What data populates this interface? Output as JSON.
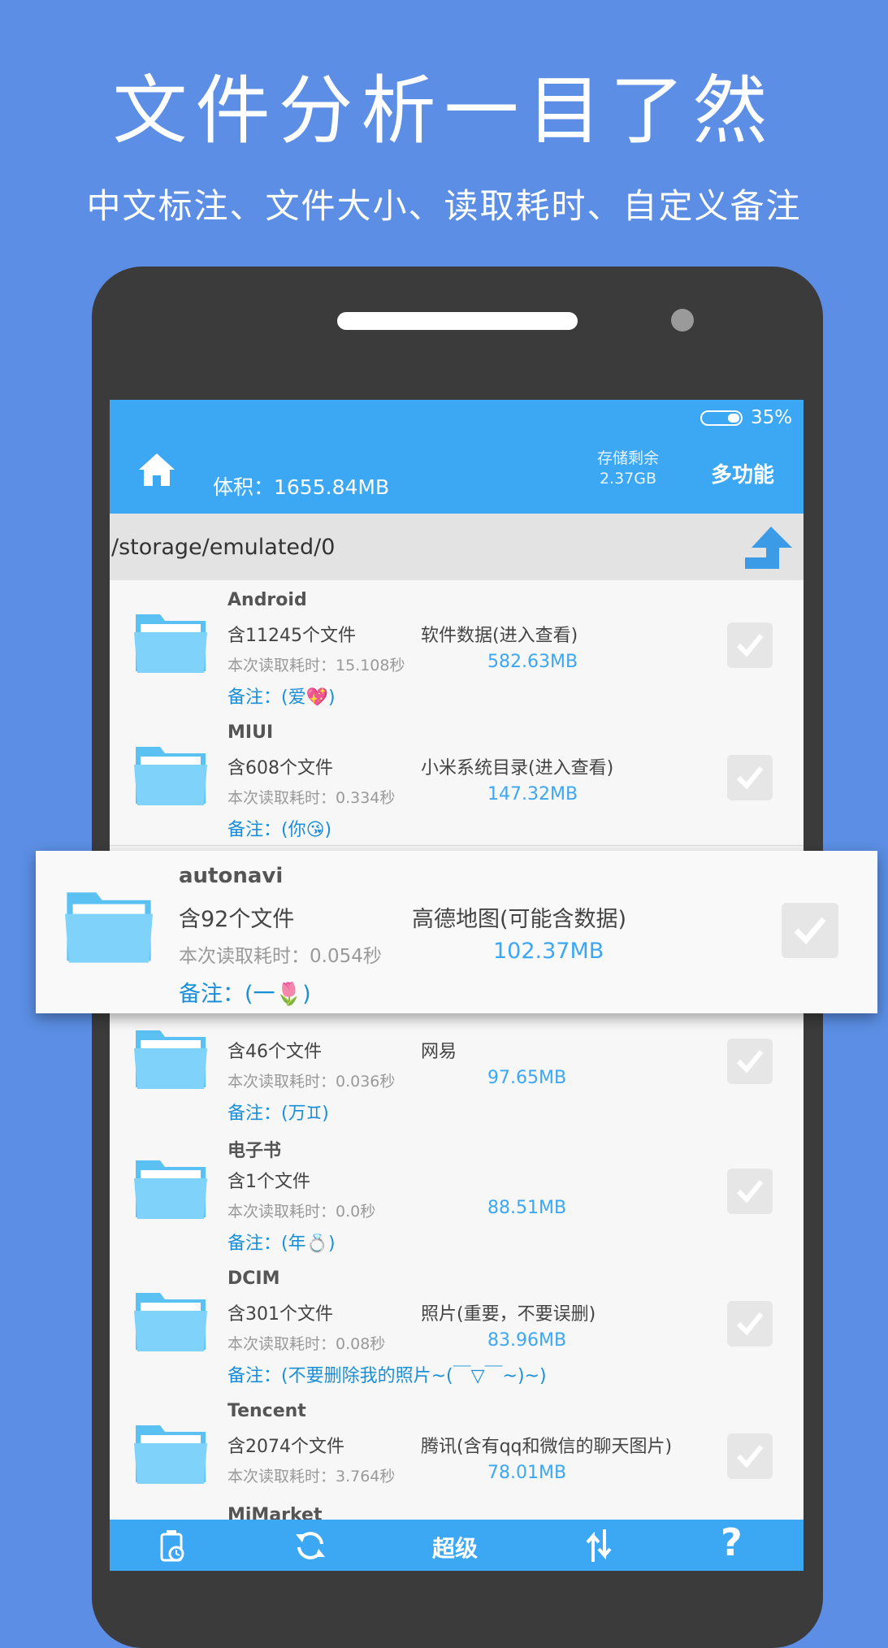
{
  "promo": {
    "headline": "文件分析一目了然",
    "subline": "中文标注、文件大小、读取耗时、自定义备注"
  },
  "status": {
    "battery_percent": "35%",
    "battery_level": 0.35
  },
  "appbar": {
    "size_label": "体积：1655.84MB",
    "storage_label": "存储剩余",
    "storage_value": "2.37GB",
    "menu_label": "多功能"
  },
  "path": "/storage/emulated/0",
  "items": [
    {
      "name": "Android",
      "count": "含11245个文件",
      "desc": "软件数据(进入查看)",
      "time": "本次读取耗时：15.108秒",
      "size": "582.63MB",
      "note": "备注：(爱💖)"
    },
    {
      "name": "MIUI",
      "count": "含608个文件",
      "desc": "小米系统目录(进入查看)",
      "time": "本次读取耗时：0.334秒",
      "size": "147.32MB",
      "note": "备注：(你😘)"
    },
    {
      "name": "",
      "count": "含46个文件",
      "desc": "网易",
      "time": "本次读取耗时：0.036秒",
      "size": "97.65MB",
      "note": "备注：(万♊)"
    },
    {
      "name": "电子书",
      "count": "含1个文件",
      "desc": "",
      "time": "本次读取耗时：0.0秒",
      "size": "88.51MB",
      "note": "备注：(年💍)"
    },
    {
      "name": "DCIM",
      "count": "含301个文件",
      "desc": "照片(重要，不要误删)",
      "time": "本次读取耗时：0.08秒",
      "size": "83.96MB",
      "note": "备注：(不要删除我的照片~(￣▽￣~)~)"
    },
    {
      "name": "Tencent",
      "count": "含2074个文件",
      "desc": "腾讯(含有qq和微信的聊天图片)",
      "time": "本次读取耗时：3.764秒",
      "size": "78.01MB",
      "note": ""
    },
    {
      "name": "MiMarket",
      "count": "",
      "desc": "",
      "time": "",
      "size": "",
      "note": ""
    }
  ],
  "highlight": {
    "name": "autonavi",
    "count": "含92个文件",
    "desc": "高德地图(可能含数据)",
    "time": "本次读取耗时：0.054秒",
    "size": "102.37MB",
    "note": "备注：(一🌷)"
  },
  "bottom": {
    "center_label": "超级"
  },
  "icons": [
    "home-icon",
    "up-arrow-icon",
    "folder-icon",
    "checkbox-icon",
    "cleaner-icon",
    "refresh-icon",
    "sort-icon",
    "help-icon"
  ],
  "colors": {
    "background": "#5b8ee4",
    "accent": "#3ca7f3",
    "note": "#1a8fd8"
  }
}
